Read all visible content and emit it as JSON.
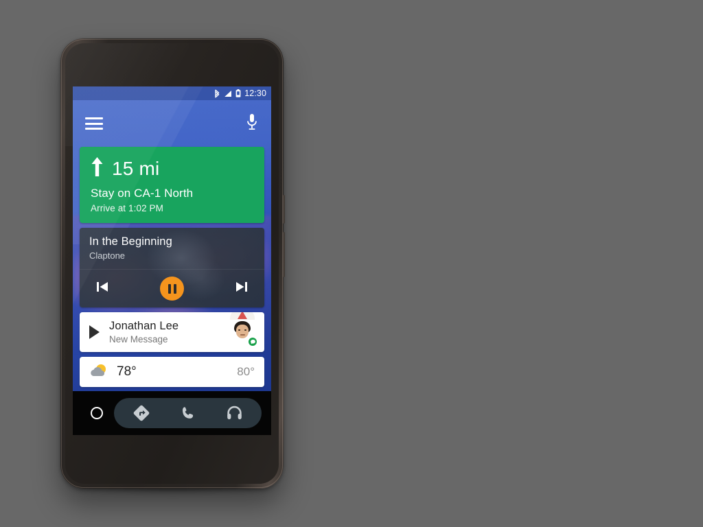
{
  "scene": {
    "background_color": "#686868",
    "device_name": "android-phone"
  },
  "status_bar": {
    "bluetooth_icon": "bluetooth-icon",
    "signal_icon": "signal-bars-icon",
    "battery_icon": "battery-icon",
    "time": "12:30"
  },
  "app_bar": {
    "menu_icon": "hamburger-menu-icon",
    "mic_icon": "microphone-icon"
  },
  "cards": {
    "navigation": {
      "direction_icon": "arrow-up-icon",
      "distance": "15 mi",
      "road": "Stay on CA-1 North",
      "eta": "Arrive at 1:02 PM",
      "color": "#18a45e"
    },
    "media": {
      "title": "In the Beginning",
      "artist": "Claptone",
      "previous_icon": "skip-previous-icon",
      "pause_icon": "pause-icon",
      "next_icon": "skip-next-icon",
      "accent_color": "#f5941d"
    },
    "message": {
      "play_icon": "play-icon",
      "sender": "Jonathan Lee",
      "subtitle": "New Message",
      "avatar_name": "contact-avatar",
      "app_badge": "messaging-app-badge"
    },
    "weather": {
      "condition_icon": "partly-cloudy-icon",
      "current_temp": "78°",
      "high_temp": "80°"
    }
  },
  "bottom_nav": {
    "home_label": "home-button",
    "items": [
      {
        "name": "navigation",
        "icon": "navigation-diamond-icon"
      },
      {
        "name": "phone",
        "icon": "phone-icon"
      },
      {
        "name": "media",
        "icon": "headphones-icon"
      }
    ]
  }
}
